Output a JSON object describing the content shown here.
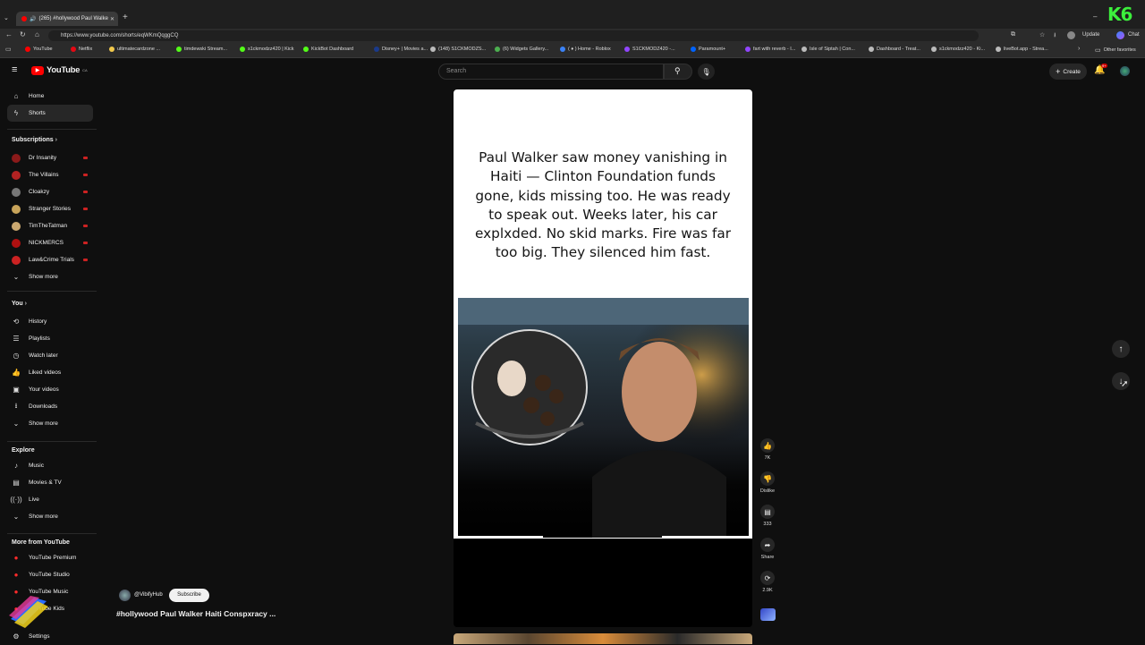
{
  "browser": {
    "tab_title": "(265) #hollywood Paul Walke",
    "url": "https://www.youtube.com/shorts/eqWKmQqggCQ",
    "update_label": "Update",
    "chat_label": "Chat",
    "other_favorites": "Other favorites",
    "bookmarks": [
      {
        "label": "YouTube",
        "color": "#ff0000"
      },
      {
        "label": "Netflix",
        "color": "#e50914"
      },
      {
        "label": "ultimatecardzone ...",
        "color": "#f2c94c"
      },
      {
        "label": "timdewski Stream...",
        "color": "#53fc18"
      },
      {
        "label": "s1ckmodzz420 | Kick",
        "color": "#53fc18"
      },
      {
        "label": "KickBot Dashboard",
        "color": "#53fc18"
      },
      {
        "label": "Disney+ | Movies a...",
        "color": "#1a3a8a"
      },
      {
        "label": "(148) S1CKMODZS...",
        "color": "#bbbbbb"
      },
      {
        "label": "(6) Widgets Gallery...",
        "color": "#4caf50"
      },
      {
        "label": "( ♦ ) Home - Roblox",
        "color": "#3b82f6"
      },
      {
        "label": "S1CKMODZ420 -...",
        "color": "#9146ff"
      },
      {
        "label": "Paramount+",
        "color": "#0064ff"
      },
      {
        "label": "fart with reverb - I...",
        "color": "#9146ff"
      },
      {
        "label": "Isle of Siptah | Con...",
        "color": "#bbbbbb"
      },
      {
        "label": "Dashboard - Treat...",
        "color": "#bbbbbb"
      },
      {
        "label": "s1ckmodzz420 - Ki...",
        "color": "#bbbbbb"
      },
      {
        "label": "liveBot.app - Strea...",
        "color": "#bbbbbb"
      }
    ]
  },
  "header": {
    "logo": "YouTube",
    "logo_sup": "CA",
    "search_placeholder": "Search",
    "create_label": "Create",
    "notif_badge": "9+"
  },
  "sidebar": {
    "top": [
      {
        "label": "Home",
        "icon": "home-icon"
      },
      {
        "label": "Shorts",
        "icon": "shorts-icon"
      }
    ],
    "subscriptions_heading": "Subscriptions",
    "subscriptions": [
      {
        "label": "Dr Insanity",
        "color": "#8b1a1a"
      },
      {
        "label": "The Villains",
        "color": "#b22222"
      },
      {
        "label": "Cloakzy",
        "color": "#777777"
      },
      {
        "label": "Stranger Stories",
        "color": "#c8a45a"
      },
      {
        "label": "TimTheTatman",
        "color": "#caa870"
      },
      {
        "label": "NICKMERCS",
        "color": "#b01010"
      },
      {
        "label": "Law&Crime Trials",
        "color": "#cc2222"
      }
    ],
    "show_more": "Show more",
    "you_heading": "You",
    "you": [
      {
        "label": "History"
      },
      {
        "label": "Playlists"
      },
      {
        "label": "Watch later"
      },
      {
        "label": "Liked videos"
      },
      {
        "label": "Your videos"
      },
      {
        "label": "Downloads"
      },
      {
        "label": "Show more"
      }
    ],
    "explore_heading": "Explore",
    "explore": [
      {
        "label": "Music"
      },
      {
        "label": "Movies & TV"
      },
      {
        "label": "Live"
      },
      {
        "label": "Show more"
      }
    ],
    "more_heading": "More from YouTube",
    "more": [
      {
        "label": "YouTube Premium"
      },
      {
        "label": "YouTube Studio"
      },
      {
        "label": "YouTube Music"
      },
      {
        "label": "YouTube Kids"
      }
    ],
    "settings": "Settings"
  },
  "short": {
    "caption": "Paul Walker saw money vanishing in Haiti — Clinton Foundation funds gone, kids missing too. He was ready to speak out. Weeks later, his car explxded. No skid marks. Fire was far too big. They silenced him fast.",
    "channel": "@VibifyHub",
    "subscribe": "Subscribe",
    "title": "#hollywood Paul Walker Haiti Conspxracy ...",
    "likes": "7K",
    "dislike_label": "Dislike",
    "comments": "333",
    "share_label": "Share",
    "remix_count": "2.9K"
  },
  "overlay": {
    "corner_badge": "K6"
  }
}
